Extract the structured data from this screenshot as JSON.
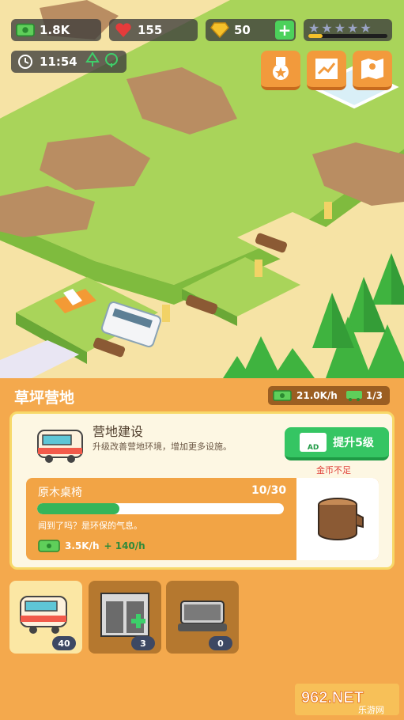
{
  "hud": {
    "cash": "1.8K",
    "hearts": "155",
    "gems": "50",
    "gems_plus": "+",
    "time": "11:54",
    "stars_total": 5,
    "stars_level_fraction": 0.18
  },
  "panel": {
    "title": "草坪营地",
    "income": "21.0K/h",
    "vehicles": "1/3"
  },
  "card": {
    "title": "营地建设",
    "subtitle": "升级改善营地环境，增加更多设施。",
    "upgrade_label": "提升5级",
    "ad_label": "AD",
    "insufficient": "金币不足",
    "item": {
      "name": "原木桌椅",
      "progress_text": "10/30",
      "progress_fraction": 0.3333,
      "hint": "闻到了吗？是环保的气息。",
      "rate": "3.5K/h",
      "bonus": "+ 140/h"
    }
  },
  "tabs": [
    {
      "name": "caravan",
      "badge": "40"
    },
    {
      "name": "garage",
      "badge": "3"
    },
    {
      "name": "grill",
      "badge": "0"
    }
  ],
  "watermark": {
    "brand": "962.NET",
    "sub": "乐游网"
  },
  "colors": {
    "accent": "#f4a94d",
    "green": "#35c563",
    "dark_pill": "#3c3c3c"
  }
}
